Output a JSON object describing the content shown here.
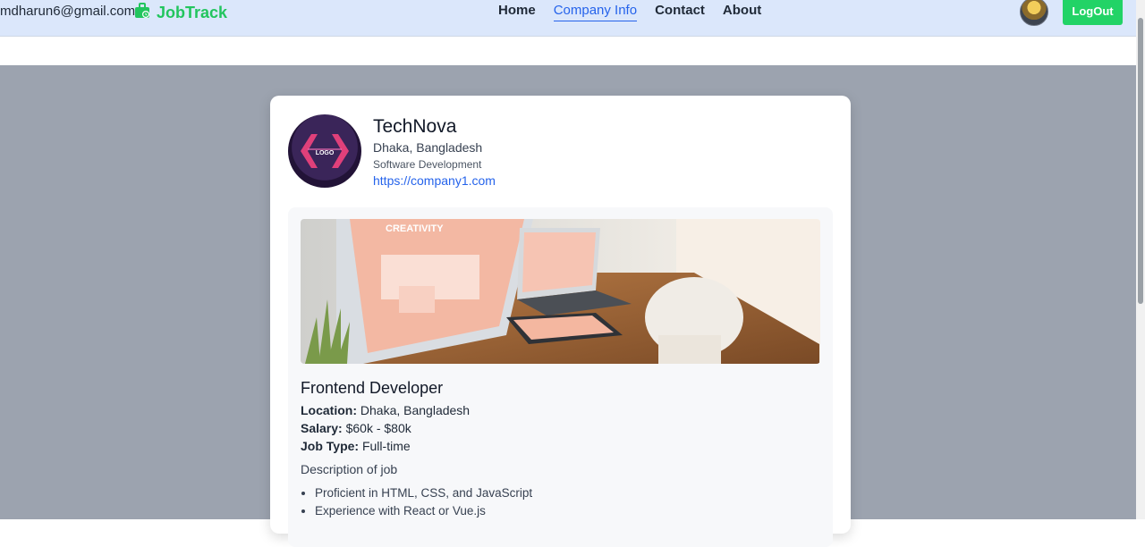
{
  "nav": {
    "email": "mdharun6@gmail.com",
    "brand": "JobTrack",
    "links": [
      {
        "label": "Home",
        "active": false
      },
      {
        "label": "Company Info",
        "active": true
      },
      {
        "label": "Contact",
        "active": false
      },
      {
        "label": "About",
        "active": false
      }
    ],
    "logout_label": "LogOut",
    "brand_color": "#22c55e",
    "active_color": "#2563eb"
  },
  "company": {
    "name": "TechNova",
    "location": "Dhaka, Bangladesh",
    "industry": "Software Development",
    "website": "https://company1.com",
    "logo_text": "LOGO"
  },
  "job": {
    "image_banner_text": "CREATIVITY",
    "title": "Frontend Developer",
    "location_label": "Location:",
    "location": "Dhaka, Bangladesh",
    "salary_label": "Salary:",
    "salary": "$60k - $80k",
    "type_label": "Job Type:",
    "type": "Full-time",
    "description": "Description of job",
    "requirements": [
      "Proficient in HTML, CSS, and JavaScript",
      "Experience with React or Vue.js"
    ]
  }
}
